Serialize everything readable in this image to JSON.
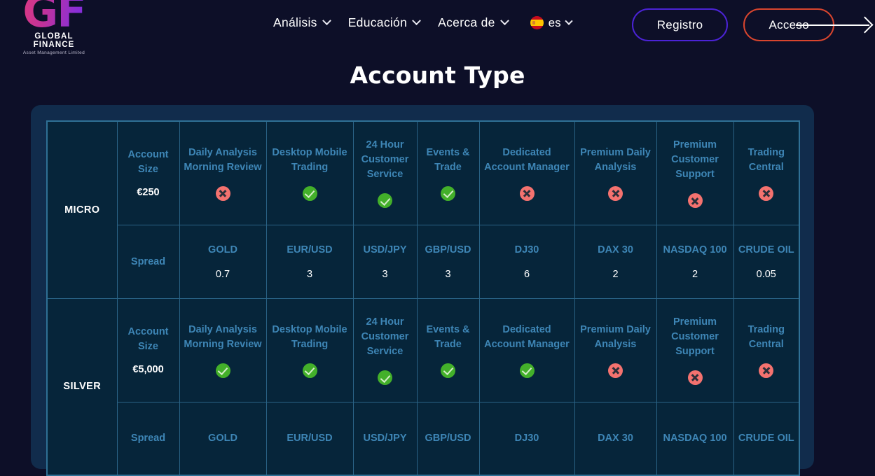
{
  "brand": {
    "mark": "GF",
    "name": "GLOBAL FINANCE",
    "tagline": "Asset Management Limited"
  },
  "nav": {
    "items": [
      {
        "label": "Análisis",
        "icon": "chevron-down-icon"
      },
      {
        "label": "Educación",
        "icon": "chevron-down-icon"
      },
      {
        "label": "Acerca de",
        "icon": "chevron-down-icon"
      }
    ],
    "language": {
      "code": "es",
      "flag": "spain-flag-icon"
    },
    "register_label": "Registro",
    "login_label": "Acceso"
  },
  "page": {
    "title": "Account Type"
  },
  "colors": {
    "page_bg": "#0d0f28",
    "panel_bg": "#112c4c",
    "cell_bg": "#06253a",
    "cell_border": "#2a6386",
    "label_blue": "#3e86b6",
    "value_white": "#ffffff",
    "yes_green": "#43b02a",
    "no_red": "#f4726f",
    "register_border": "#4b23d6",
    "login_border": "#d9452e"
  },
  "table": {
    "feature_labels": [
      "Account Size",
      "Daily Analysis Morning Review",
      "Desktop Mobile Trading",
      "24 Hour Customer Service",
      "Events & Trade",
      "Dedicated Account Manager",
      "Premium Daily Analysis",
      "Premium Customer Support",
      "Trading Central"
    ],
    "spread_label": "Spread",
    "instrument_labels": [
      "GOLD",
      "EUR/USD",
      "USD/JPY",
      "GBP/USD",
      "DJ30",
      "DAX 30",
      "NASDAQ 100",
      "CRUDE OIL"
    ],
    "tiers": [
      {
        "name": "MICRO",
        "account_size": "€250",
        "features": [
          "no",
          "yes",
          "yes",
          "yes",
          "no",
          "no",
          "no",
          "no"
        ],
        "spreads": [
          "0.7",
          "3",
          "3",
          "3",
          "6",
          "2",
          "2",
          "0.05"
        ]
      },
      {
        "name": "SILVER",
        "account_size": "€5,000",
        "features": [
          "yes",
          "yes",
          "yes",
          "yes",
          "yes",
          "no",
          "no",
          "no"
        ],
        "spreads": [
          "",
          "",
          "",
          "",
          "",
          "",
          "",
          ""
        ]
      }
    ]
  }
}
